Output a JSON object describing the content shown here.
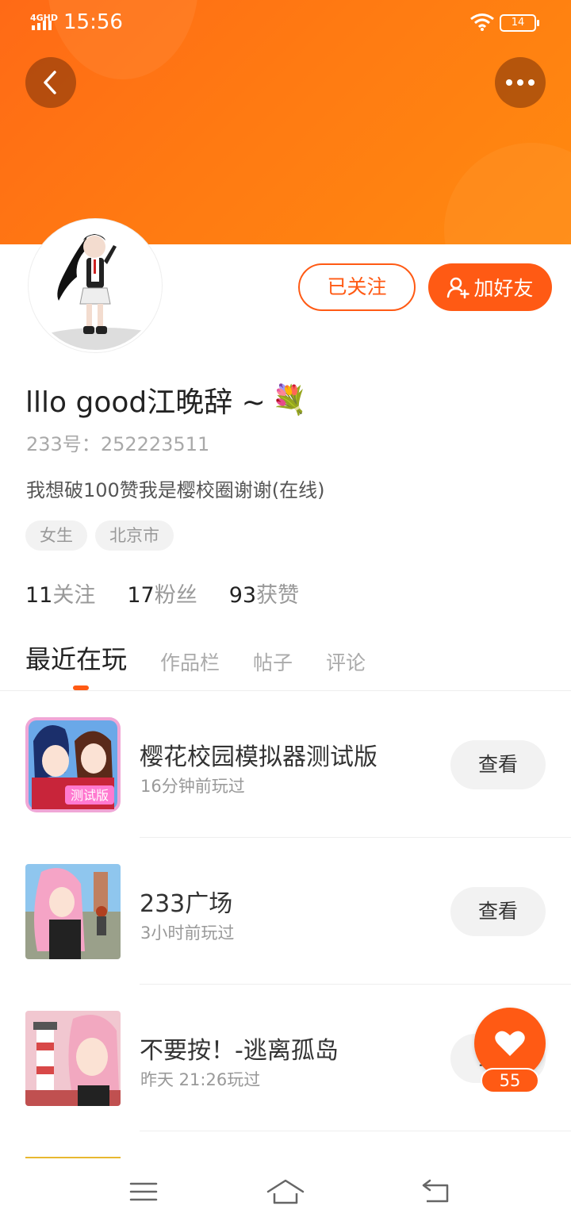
{
  "status_bar": {
    "network": "4GHD",
    "time": "15:56",
    "battery": "14"
  },
  "header": {
    "back_icon": "chevron-left-icon",
    "more_icon": "more-dots-icon"
  },
  "profile": {
    "nickname": "lllo good江晚辞 ~",
    "nickname_emoji": "💐",
    "uid_label": "233号：",
    "uid": "252223511",
    "bio": "我想破100赞我是樱校圈谢谢(在线)",
    "tags": [
      "女生",
      "北京市"
    ],
    "followed_label": "已关注",
    "add_friend_label": "加好友"
  },
  "stats": [
    {
      "num": "11",
      "label": "关注"
    },
    {
      "num": "17",
      "label": "粉丝"
    },
    {
      "num": "93",
      "label": "获赞"
    }
  ],
  "tabs": [
    {
      "label": "最近在玩",
      "active": true
    },
    {
      "label": "作品栏",
      "active": false
    },
    {
      "label": "帖子",
      "active": false
    },
    {
      "label": "评论",
      "active": false
    }
  ],
  "games": [
    {
      "title": "樱花校园模拟器测试版",
      "sub": "16分钟前玩过",
      "button": "查看"
    },
    {
      "title": "233广场",
      "sub": "3小时前玩过",
      "button": "查看"
    },
    {
      "title": "不要按！-逃离孤岛",
      "sub": "昨天 21:26玩过",
      "button": "查看"
    }
  ],
  "like_fab": {
    "count": "55"
  },
  "colors": {
    "accent": "#ff5a14",
    "banner": "#ff7a12"
  }
}
